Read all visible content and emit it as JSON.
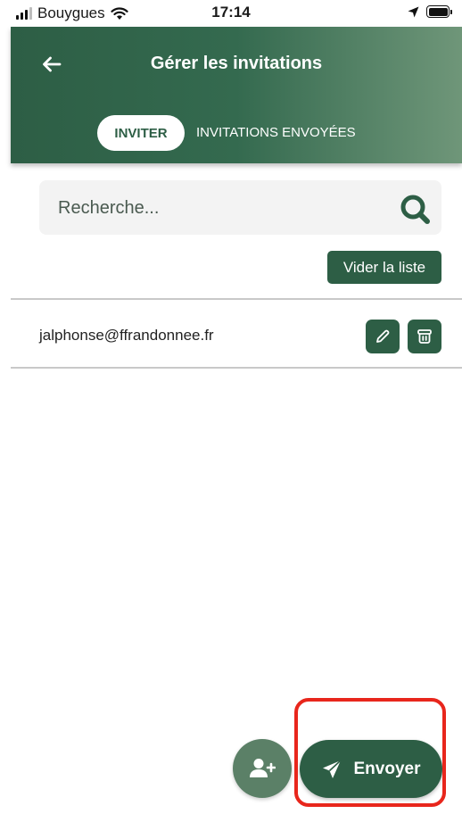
{
  "status_bar": {
    "carrier": "Bouygues",
    "time": "17:14"
  },
  "header": {
    "title": "Gérer les invitations",
    "back_icon": "arrow-left-icon"
  },
  "tabs": [
    {
      "label": "INVITER",
      "active": true
    },
    {
      "label": "INVITATIONS ENVOYÉES",
      "active": false
    }
  ],
  "search": {
    "placeholder": "Recherche...",
    "value": ""
  },
  "clear_button": {
    "label": "Vider la liste"
  },
  "invitations": [
    {
      "email": "jalphonse@ffrandonnee.fr"
    }
  ],
  "actions": {
    "add_user_icon": "user-plus-icon",
    "send_label": "Envoyer",
    "send_icon": "paper-plane-icon"
  },
  "colors": {
    "primary": "#2d5e45",
    "header_end": "#6f9679",
    "highlight": "#e8261c"
  }
}
